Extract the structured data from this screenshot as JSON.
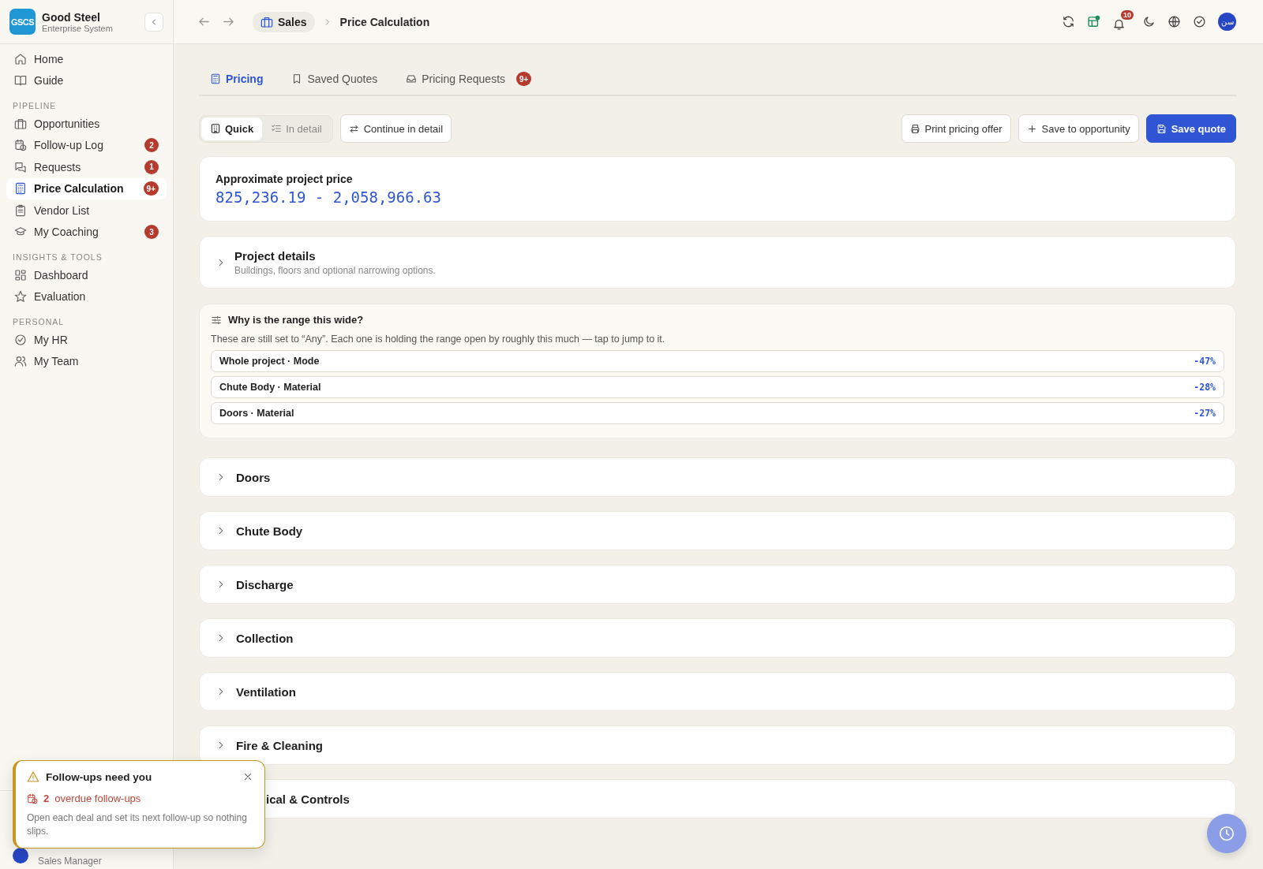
{
  "brand": {
    "logo": "GSCS",
    "name": "Good Steel",
    "subtitle": "Enterprise System"
  },
  "sidebar": {
    "sections": [
      {
        "items": [
          {
            "label": "Home",
            "selected": false
          },
          {
            "label": "Guide",
            "selected": false
          }
        ]
      },
      {
        "heading": "PIPELINE",
        "items": [
          {
            "label": "Opportunities",
            "selected": false
          },
          {
            "label": "Follow-up Log",
            "selected": false,
            "badge": "2"
          },
          {
            "label": "Requests",
            "selected": false,
            "badge": "1"
          },
          {
            "label": "Price Calculation",
            "selected": true,
            "badge": "9+"
          },
          {
            "label": "Vendor List",
            "selected": false
          },
          {
            "label": "My Coaching",
            "selected": false,
            "badge": "3"
          }
        ]
      },
      {
        "heading": "INSIGHTS & TOOLS",
        "items": [
          {
            "label": "Dashboard",
            "selected": false
          },
          {
            "label": "Evaluation",
            "selected": false
          }
        ]
      },
      {
        "heading": "PERSONAL",
        "items": [
          {
            "label": "My HR",
            "selected": false
          },
          {
            "label": "My Team",
            "selected": false
          }
        ]
      }
    ],
    "user": {
      "role": "Sales Manager"
    }
  },
  "header": {
    "breadcrumb": [
      {
        "kind": "chip",
        "label": "Sales"
      },
      {
        "kind": "current",
        "label": "Price Calculation"
      }
    ],
    "notifications": "10",
    "avatar": "سن"
  },
  "tabs": [
    {
      "label": "Pricing",
      "selected": true
    },
    {
      "label": "Saved Quotes",
      "selected": false
    },
    {
      "label": "Pricing Requests",
      "selected": false,
      "badge": "9+"
    }
  ],
  "modes": [
    {
      "label": "Quick",
      "selected": true
    },
    {
      "label": "In detail",
      "selected": false
    }
  ],
  "continue_button": "Continue in detail",
  "actions": [
    {
      "kind": "outline",
      "label": "Print pricing offer"
    },
    {
      "kind": "outline",
      "label": "Save to opportunity"
    },
    {
      "kind": "primary",
      "label": "Save quote"
    }
  ],
  "price": {
    "label": "Approximate project price",
    "value": "825,236.19 - 2,058,966.63"
  },
  "project_details": {
    "title": "Project details",
    "subtitle": "Buildings, floors and optional narrowing options.",
    "expanded": false
  },
  "range": {
    "title": "Why is the range this wide?",
    "description": "These are still set to “Any”. Each one is holding the range open by roughly this much — tap to jump to it.",
    "factors": [
      {
        "label": "Whole project · Mode",
        "value": "-47%"
      },
      {
        "label": "Chute Body · Material",
        "value": "-28%"
      },
      {
        "label": "Doors · Material",
        "value": "-27%"
      }
    ]
  },
  "sections": [
    {
      "title": "Doors",
      "expanded": false
    },
    {
      "title": "Chute Body",
      "expanded": false
    },
    {
      "title": "Discharge",
      "expanded": false
    },
    {
      "title": "Collection",
      "expanded": false
    },
    {
      "title": "Ventilation",
      "expanded": false
    },
    {
      "title": "Fire & Cleaning",
      "expanded": false
    },
    {
      "title": "ical & Controls",
      "kind": "covered"
    }
  ],
  "toast": {
    "title": "Follow-ups need you",
    "count": "2",
    "count_text": "overdue follow-ups",
    "body": "Open each deal and set its next follow-up so nothing slips."
  }
}
